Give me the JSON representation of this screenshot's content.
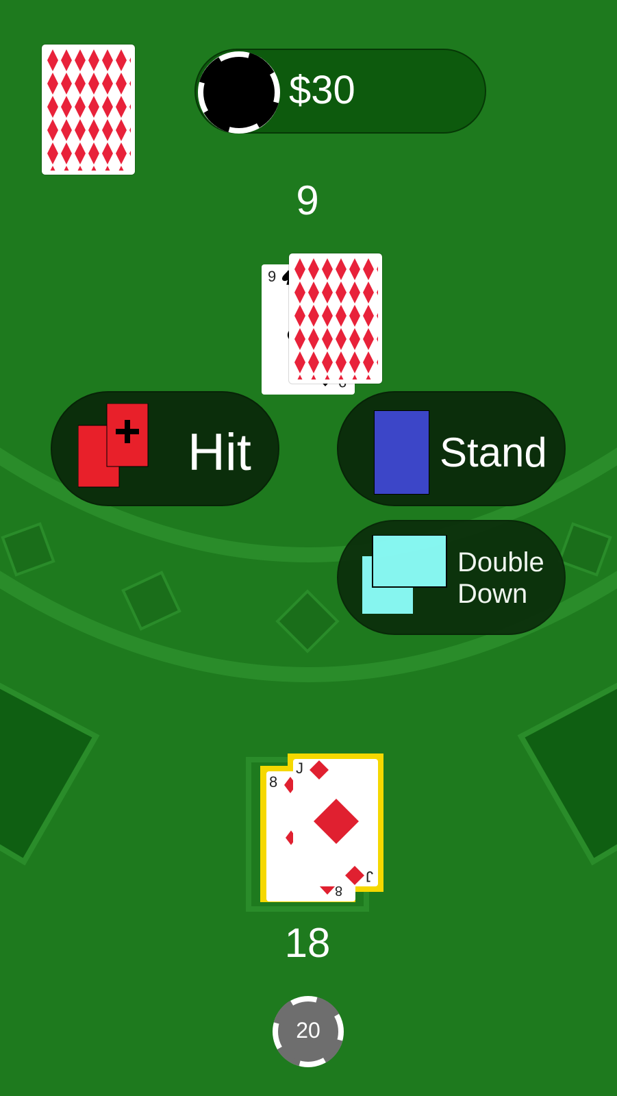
{
  "balance": {
    "amount": "$30"
  },
  "dealer": {
    "score": "9",
    "cards": [
      {
        "rank": "9",
        "suit": "spades",
        "face_up": true
      },
      {
        "face_up": false
      }
    ]
  },
  "player": {
    "score": "18",
    "cards": [
      {
        "rank": "8",
        "suit": "diamonds"
      },
      {
        "rank": "J",
        "suit": "diamonds"
      }
    ]
  },
  "buttons": {
    "hit": "Hit",
    "stand": "Stand",
    "double_down_line1": "Double",
    "double_down_line2": "Down"
  },
  "bet_chip": {
    "value": "20"
  },
  "colors": {
    "felt": "#1e7a1e",
    "card_back_pattern": "#e8223a",
    "hit_icon": "#e8202a",
    "stand_icon": "#3c46c8",
    "double_icon": "#8effff",
    "highlight": "#f5d800",
    "chip_grey": "#6e6e6e"
  }
}
